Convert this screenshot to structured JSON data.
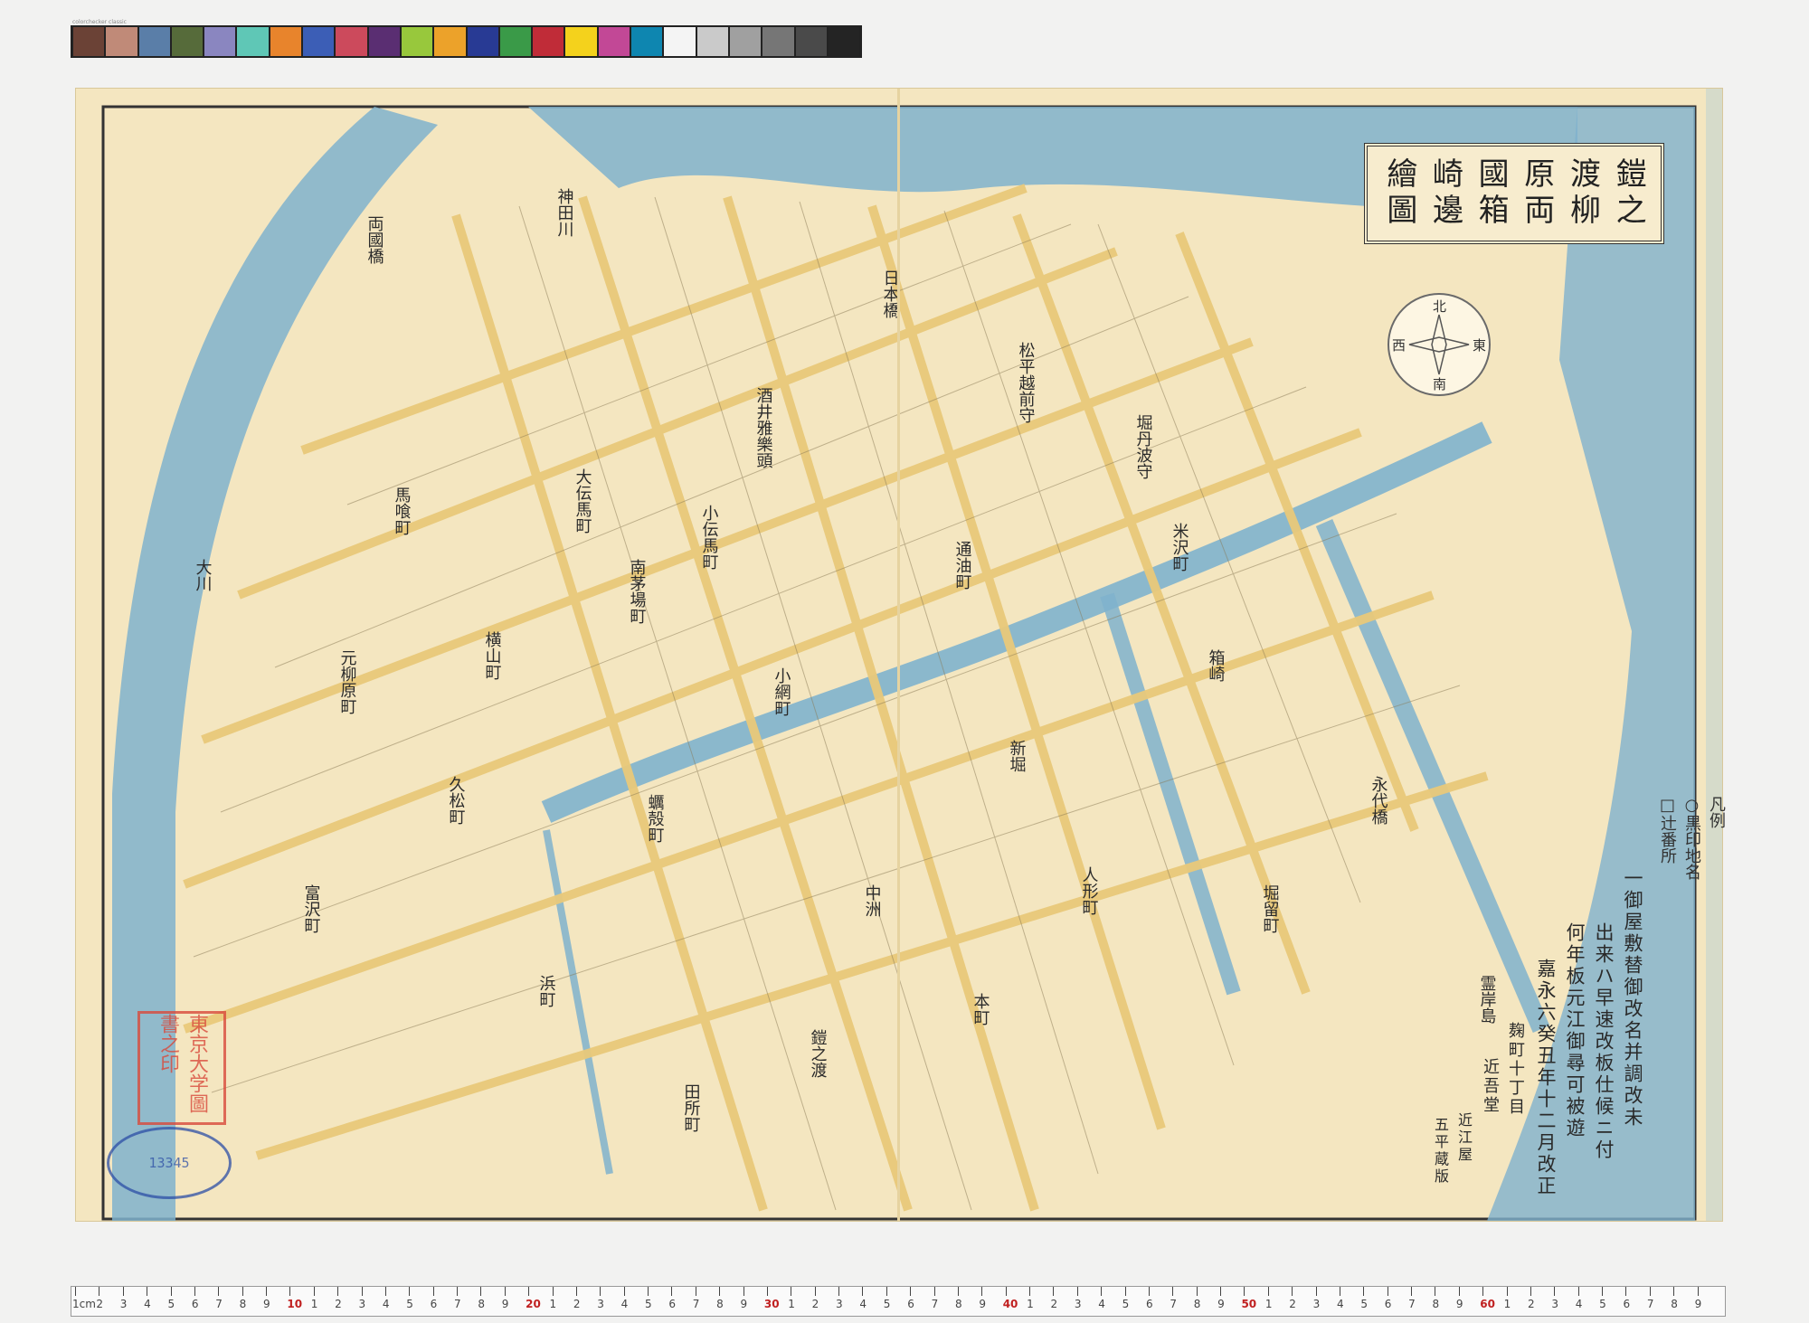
{
  "color_checker": {
    "label": "colorchecker classic",
    "swatches": [
      "#6b4236",
      "#c08a78",
      "#5a7ea8",
      "#566b3a",
      "#8a86c0",
      "#5fc7b6",
      "#e8842c",
      "#3c5eb6",
      "#cc4a5c",
      "#5a2e72",
      "#98c83c",
      "#eca22a",
      "#283a94",
      "#3a9a48",
      "#c02c38",
      "#f4d21c",
      "#c24896",
      "#0e86b0",
      "#f4f4f4",
      "#cacaca",
      "#a0a0a0",
      "#767676",
      "#4a4a4a",
      "#242424"
    ]
  },
  "title": {
    "lines": [
      "鎧之",
      "渡柳",
      "原両",
      "國箱",
      "崎邊",
      "繪圖"
    ]
  },
  "compass": {
    "directions": [
      "北",
      "東",
      "南",
      "西"
    ]
  },
  "map_labels": [
    "大川",
    "神田川",
    "松平越前守",
    "堀丹波守",
    "日本橋",
    "酒井雅樂頭",
    "南茅場町",
    "両國橋",
    "永代橋",
    "霊岸島",
    "小網町",
    "新堀",
    "箱崎",
    "中洲",
    "浜町",
    "蠣殻町",
    "元柳原町",
    "久松町",
    "富沢町",
    "大伝馬町",
    "小伝馬町",
    "通油町",
    "人形町",
    "堀留町",
    "米沢町",
    "馬喰町",
    "横山町",
    "鎧之渡",
    "本町",
    "田所町"
  ],
  "legend": {
    "heading": "凡例",
    "items": [
      "○黒印地名",
      "□辻番所"
    ]
  },
  "colophon": {
    "lines": [
      "一御屋敷替御改名并調改未",
      "出来ハ早速改板仕候ニ付",
      "何年板元江御尋可被遊",
      "嘉永六癸丑年十二月改正"
    ],
    "publisher": [
      "麹町十丁目",
      "近吾堂",
      "近江屋",
      "五平蔵版"
    ]
  },
  "seals": {
    "red": "東京大学圖書之印",
    "blue": "13345"
  },
  "ruler": {
    "ticks": [
      "1cm",
      "2",
      "3",
      "4",
      "5",
      "6",
      "7",
      "8",
      "9",
      "10",
      "1",
      "2",
      "3",
      "4",
      "5",
      "6",
      "7",
      "8",
      "9",
      "20",
      "1",
      "2",
      "3",
      "4",
      "5",
      "6",
      "7",
      "8",
      "9",
      "30",
      "1",
      "2",
      "3",
      "4",
      "5",
      "6",
      "7",
      "8",
      "9",
      "40",
      "1",
      "2",
      "3",
      "4",
      "5",
      "6",
      "7",
      "8",
      "9",
      "50",
      "1",
      "2",
      "3",
      "4",
      "5",
      "6",
      "7",
      "8",
      "9",
      "60",
      "1",
      "2",
      "3",
      "4",
      "5",
      "6",
      "7",
      "8",
      "9"
    ]
  },
  "colors": {
    "paper": "#f4e6c0",
    "water": "#7fb2cd",
    "road": "#e9c97a",
    "ink": "#2b2b2b",
    "seal_red": "#d94a3c",
    "seal_blue": "#2c4ea6"
  }
}
